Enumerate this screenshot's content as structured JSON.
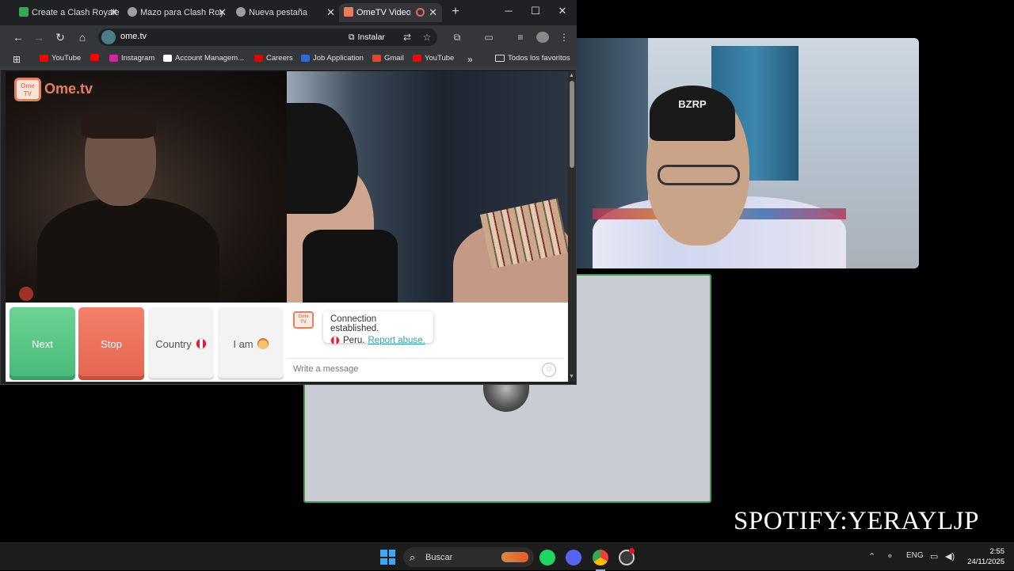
{
  "browser": {
    "tabs": [
      {
        "title": "Create a Clash Royale",
        "favicon_color": "#34a853",
        "active": false
      },
      {
        "title": "Mazo para Clash Roy",
        "favicon_color": "#9aa0a6",
        "active": false
      },
      {
        "title": "Nueva pestaña",
        "favicon_color": "#9aa0a6",
        "active": false
      },
      {
        "title": "OmeTV Video Ch",
        "favicon_color": "#e97e5e",
        "active": true
      }
    ],
    "new_tab_symbol": "+",
    "address": "ome.tv",
    "install_label": "Instalar",
    "bookmarks": [
      {
        "label": "YouTube",
        "color": "#ff0000"
      },
      {
        "label": "",
        "color": "#ff0000"
      },
      {
        "label": "Instagram",
        "color": "#d6249f"
      },
      {
        "label": "Account Managem...",
        "color": "#ffffff"
      },
      {
        "label": "Careers",
        "color": "#e60000"
      },
      {
        "label": "Job Application",
        "color": "#2b6cd8"
      },
      {
        "label": "Gmail",
        "color": "#ea4335"
      },
      {
        "label": "YouTube",
        "color": "#ff0000"
      }
    ],
    "bookmarks_overflow": "»",
    "all_favorites": "Todos los favoritos"
  },
  "ometv": {
    "logo_small": "Ome TV",
    "logo_text": "Ome.tv",
    "buttons": {
      "next": "Next",
      "stop": "Stop",
      "country": "Country",
      "i_am": "I am"
    },
    "chat": {
      "status": "Connection established.",
      "country": "Peru.",
      "report": "Report abuse.",
      "placeholder": "Write a message"
    }
  },
  "webcam": {
    "cap_text": "BZRP"
  },
  "caption": "SPOTIFY:YERAYLJP",
  "taskbar": {
    "search_placeholder": "Buscar",
    "language": "ENG",
    "time": "2:55",
    "date": "24/11/2025"
  }
}
